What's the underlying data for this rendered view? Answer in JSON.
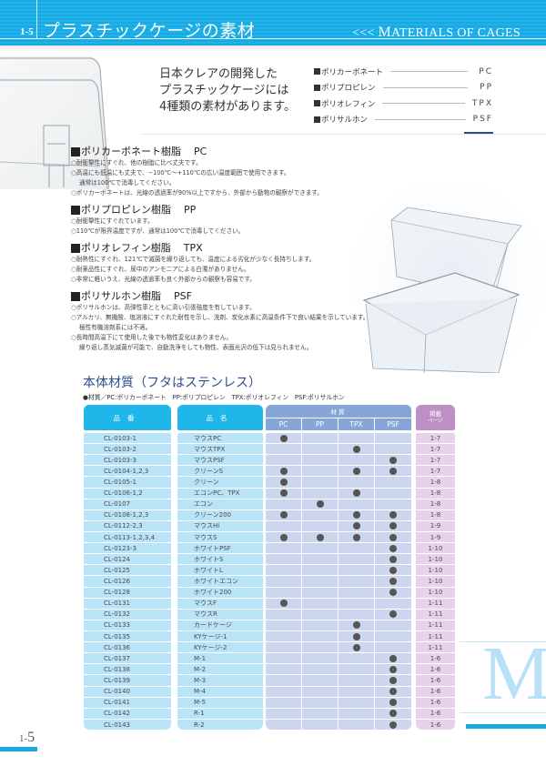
{
  "header": {
    "section_number": "1-5",
    "title_ja": "プラスチックケージの素材",
    "title_en_prefix": "<<< ",
    "title_en_initial": "M",
    "title_en_rest": "ATERIALS OF CAGES"
  },
  "intro": {
    "lines": [
      "日本クレアの開発した",
      "プラスチックケージには",
      "4種類の素材があります。"
    ]
  },
  "materials": [
    {
      "name": "ポリカーボネート",
      "code": "PC"
    },
    {
      "name": "ポリプロピレン",
      "code": "PP"
    },
    {
      "name": "ポリオレフィン",
      "code": "TPX"
    },
    {
      "name": "ポリサルホン",
      "code": "PSF"
    }
  ],
  "resins": [
    {
      "title": "ポリカーボネート樹脂",
      "code": "PC",
      "lines": [
        {
          "text": "○耐衝撃性にすぐれ、他の樹脂に比べ丈夫です。",
          "indent": false
        },
        {
          "text": "○高温にも低温にも丈夫で、−100℃〜+110℃の広い温度範囲で使用できます。",
          "indent": false
        },
        {
          "text": "通常は100℃で消毒してください。",
          "indent": true
        },
        {
          "text": "○ポリカーボネートは、光線の透過率が90%以上ですから、外部から動物の観察ができます。",
          "indent": false
        }
      ]
    },
    {
      "title": "ポリプロピレン樹脂",
      "code": "PP",
      "lines": [
        {
          "text": "○耐衝撃性にすぐれています。",
          "indent": false
        },
        {
          "text": "○110℃が限界温度ですが、通常は100℃で消毒してください。",
          "indent": false
        }
      ]
    },
    {
      "title": "ポリオレフィン樹脂",
      "code": "TPX",
      "lines": [
        {
          "text": "○耐熱性にすぐれ、121℃で滅菌を繰り返しても、温度による劣化が少なく長持ちします。",
          "indent": false
        },
        {
          "text": "○耐薬品性にすぐれ、尿中のアンモニアによる白濁がありません。",
          "indent": false
        },
        {
          "text": "○非常に軽いうえ、光線の透過率も良く外部からの観察も容易です。",
          "indent": false
        }
      ]
    },
    {
      "title": "ポリサルホン樹脂",
      "code": "PSF",
      "lines": [
        {
          "text": "○ポリサルホンは、高弾性率とともに高い引張強度を有しています。",
          "indent": false
        },
        {
          "text": "○アルカリ、無機酸、塩溶液にすぐれた耐性を示し、洗剤、炭化水素に高温条件下で良い結果を示しています。",
          "indent": false
        },
        {
          "text": "極性有機溶剤系には不適。",
          "indent": true
        },
        {
          "text": "○長時間高温下にて使用した後でも物性変化はありません。",
          "indent": false
        },
        {
          "text": "繰り返し蒸気滅菌が可能で、自動洗浄をしても物性、表面光沢の低下は見られません。",
          "indent": true
        }
      ]
    }
  ],
  "table": {
    "title": "本体材質（フタはステンレス）",
    "note": "●材質／PC:ポリカーボネート　PP:ポリプロピレン　TPX:ポリオレフィン　PSF:ポリサルホン",
    "headers": {
      "code": "品番",
      "name": "品名",
      "material": "材質",
      "materials": [
        "PC",
        "PP",
        "TPX",
        "PSF"
      ],
      "page_line1": "掲載",
      "page_line2": "ページ"
    },
    "rows": [
      {
        "code": "CL-0103-1",
        "name": "マウスPC",
        "pc": true,
        "pp": false,
        "tpx": false,
        "psf": false,
        "page": "1-7"
      },
      {
        "code": "CL-0103-2",
        "name": "マウスTPX",
        "pc": false,
        "pp": false,
        "tpx": true,
        "psf": false,
        "page": "1-7"
      },
      {
        "code": "CL-0103-3",
        "name": "マウスPSF",
        "pc": false,
        "pp": false,
        "tpx": false,
        "psf": true,
        "page": "1-7"
      },
      {
        "code": "CL-0104-1,2,3",
        "name": "クリーンS",
        "pc": true,
        "pp": false,
        "tpx": true,
        "psf": true,
        "page": "1-7"
      },
      {
        "code": "CL-0105-1",
        "name": "クリーン",
        "pc": true,
        "pp": false,
        "tpx": false,
        "psf": false,
        "page": "1-8"
      },
      {
        "code": "CL-0106-1,2",
        "name": "エコンPC、TPX",
        "pc": true,
        "pp": false,
        "tpx": true,
        "psf": false,
        "page": "1-8"
      },
      {
        "code": "CL-0107",
        "name": "エコン",
        "pc": false,
        "pp": true,
        "tpx": false,
        "psf": false,
        "page": "1-8"
      },
      {
        "code": "CL-0108-1,2,3",
        "name": "クリーン200",
        "pc": true,
        "pp": false,
        "tpx": true,
        "psf": true,
        "page": "1-8"
      },
      {
        "code": "CL-0112-2,3",
        "name": "マウスHi",
        "pc": false,
        "pp": false,
        "tpx": true,
        "psf": true,
        "page": "1-9"
      },
      {
        "code": "CL-0113-1,2,3,4",
        "name": "マウスS",
        "pc": true,
        "pp": true,
        "tpx": true,
        "psf": true,
        "page": "1-9"
      },
      {
        "code": "CL-0123-3",
        "name": "ホワイトPSF",
        "pc": false,
        "pp": false,
        "tpx": false,
        "psf": true,
        "page": "1-10"
      },
      {
        "code": "CL-0124",
        "name": "ホワイトS",
        "pc": false,
        "pp": false,
        "tpx": false,
        "psf": true,
        "page": "1-10"
      },
      {
        "code": "CL-0125",
        "name": "ホワイトL",
        "pc": false,
        "pp": false,
        "tpx": false,
        "psf": true,
        "page": "1-10"
      },
      {
        "code": "CL-0126",
        "name": "ホワイトエコン",
        "pc": false,
        "pp": false,
        "tpx": false,
        "psf": true,
        "page": "1-10"
      },
      {
        "code": "CL-0128",
        "name": "ホワイト200",
        "pc": false,
        "pp": false,
        "tpx": false,
        "psf": true,
        "page": "1-10"
      },
      {
        "code": "CL-0131",
        "name": "マウスF",
        "pc": true,
        "pp": false,
        "tpx": false,
        "psf": false,
        "page": "1-11"
      },
      {
        "code": "CL-0132",
        "name": "マウスR",
        "pc": false,
        "pp": false,
        "tpx": false,
        "psf": true,
        "page": "1-11"
      },
      {
        "code": "CL-0133",
        "name": "カードケージ",
        "pc": false,
        "pp": false,
        "tpx": true,
        "psf": false,
        "page": "1-11"
      },
      {
        "code": "CL-0135",
        "name": "KYケージ-1",
        "pc": false,
        "pp": false,
        "tpx": true,
        "psf": false,
        "page": "1-11"
      },
      {
        "code": "CL-0136",
        "name": "KYケージ-2",
        "pc": false,
        "pp": false,
        "tpx": true,
        "psf": false,
        "page": "1-11"
      },
      {
        "code": "CL-0137",
        "name": "M-1",
        "pc": false,
        "pp": false,
        "tpx": false,
        "psf": true,
        "page": "1-6"
      },
      {
        "code": "CL-0138",
        "name": "M-2",
        "pc": false,
        "pp": false,
        "tpx": false,
        "psf": true,
        "page": "1-6"
      },
      {
        "code": "CL-0139",
        "name": "M-3",
        "pc": false,
        "pp": false,
        "tpx": false,
        "psf": true,
        "page": "1-6"
      },
      {
        "code": "CL-0140",
        "name": "M-4",
        "pc": false,
        "pp": false,
        "tpx": false,
        "psf": true,
        "page": "1-6"
      },
      {
        "code": "CL-0141",
        "name": "M-5",
        "pc": false,
        "pp": false,
        "tpx": false,
        "psf": true,
        "page": "1-6"
      },
      {
        "code": "CL-0142",
        "name": "R-1",
        "pc": false,
        "pp": false,
        "tpx": false,
        "psf": true,
        "page": "1-6"
      },
      {
        "code": "CL-0143",
        "name": "R-2",
        "pc": false,
        "pp": false,
        "tpx": false,
        "psf": true,
        "page": "1-6"
      }
    ]
  },
  "side_index": {
    "letter": "M"
  },
  "footer": {
    "page_prefix": "1-",
    "page_number": "5"
  },
  "colors": {
    "brand_blue": "#19a9e2",
    "table_header_blue": "#1fb7ea",
    "material_header": "#85a6d6",
    "page_header": "#be8fc5",
    "title_navy": "#2d4f8f"
  }
}
